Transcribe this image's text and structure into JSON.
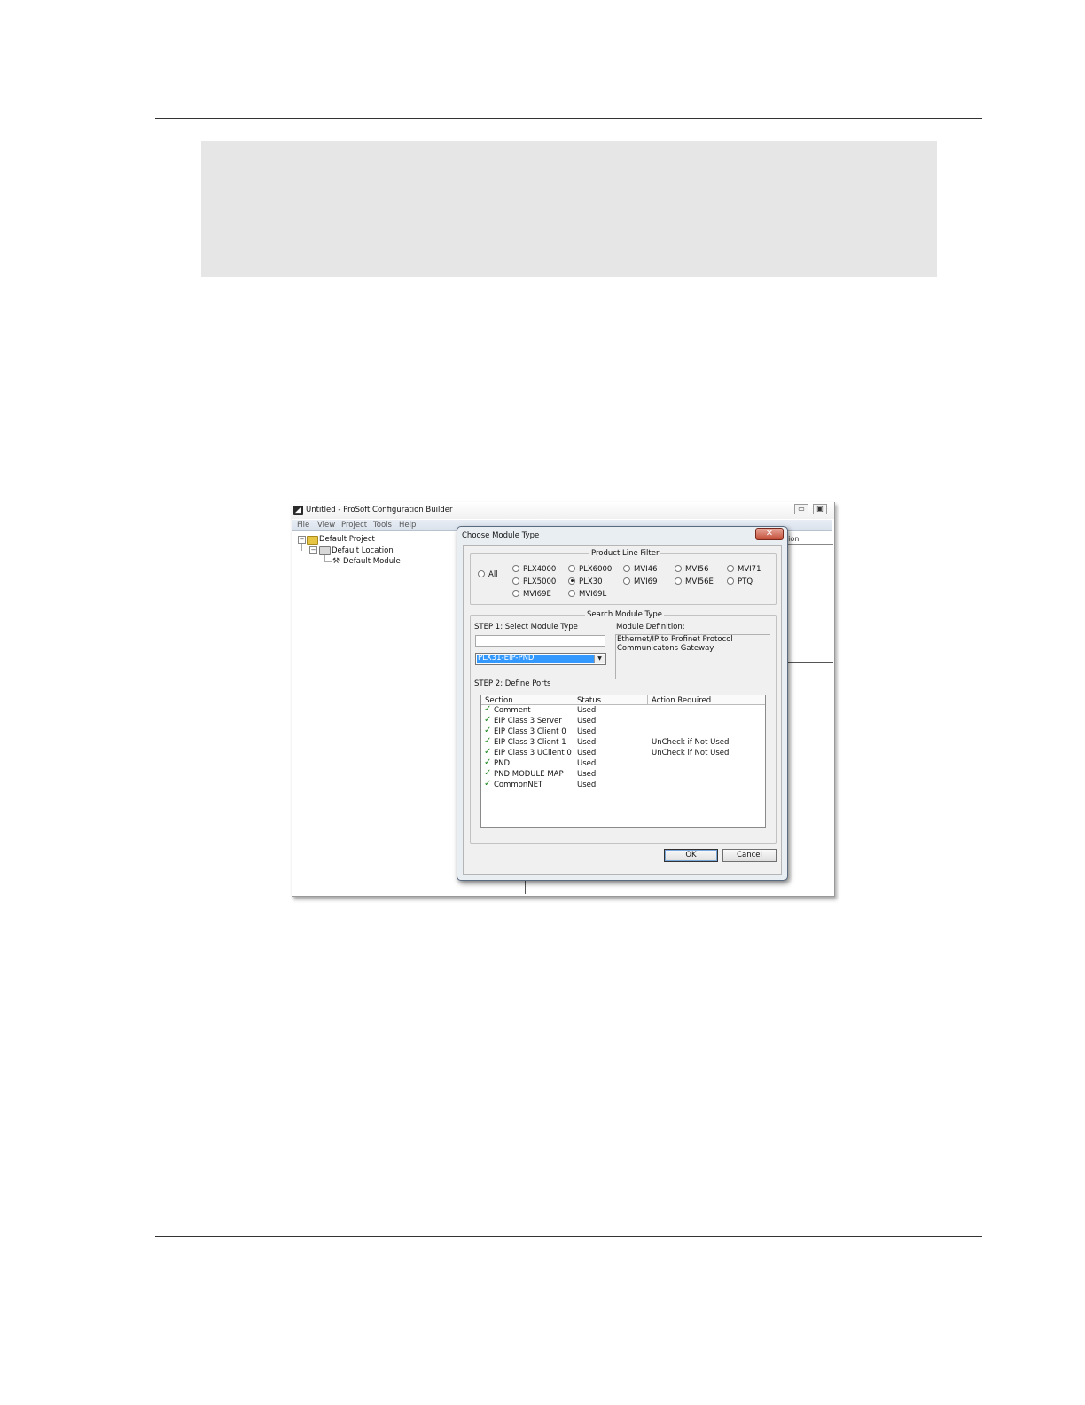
{
  "app": {
    "title": "Untitled - ProSoft Configuration Builder",
    "menu": [
      "File",
      "View",
      "Project",
      "Tools",
      "Help"
    ],
    "tree": {
      "project": "Default Project",
      "location": "Default Location",
      "module": "Default Module"
    },
    "background_column_header": "tion"
  },
  "dialog": {
    "title": "Choose Module Type",
    "close_glyph": "✕",
    "product_line_filter": {
      "legend": "Product Line Filter",
      "options": [
        "All",
        "PLX4000",
        "PLX6000",
        "MVI46",
        "MVI56",
        "MVI71",
        "PLX5000",
        "PLX30",
        "MVI69",
        "MVI56E",
        "PTQ",
        "MVI69E",
        "MVI69L"
      ],
      "selected": "PLX30"
    },
    "search": {
      "legend": "Search Module Type",
      "step1_label": "STEP 1: Select Module Type",
      "search_value": "",
      "selected_module": "PLX31-EIP-PND",
      "definition_label": "Module Definition:",
      "definition_line1": "Ethernet/IP to Profinet Protocol",
      "definition_line2": "Communicatons Gateway",
      "step2_label": "STEP 2: Define Ports"
    },
    "ports_table": {
      "columns": [
        "Section",
        "Status",
        "Action Required"
      ],
      "rows": [
        {
          "section": "Comment",
          "status": "Used",
          "action": ""
        },
        {
          "section": "EIP Class 3 Server",
          "status": "Used",
          "action": ""
        },
        {
          "section": "EIP Class 3 Client 0",
          "status": "Used",
          "action": ""
        },
        {
          "section": "EIP Class 3 Client 1",
          "status": "Used",
          "action": "UnCheck if Not Used"
        },
        {
          "section": "EIP Class 3 UClient 0",
          "status": "Used",
          "action": "UnCheck if Not Used"
        },
        {
          "section": "PND",
          "status": "Used",
          "action": ""
        },
        {
          "section": "PND MODULE MAP",
          "status": "Used",
          "action": ""
        },
        {
          "section": "CommonNET",
          "status": "Used",
          "action": ""
        }
      ]
    },
    "ok_label": "OK",
    "cancel_label": "Cancel"
  },
  "colors": {
    "selection": "#3399ff",
    "check": "#1e8a1e",
    "close_button": "#c24d37"
  }
}
